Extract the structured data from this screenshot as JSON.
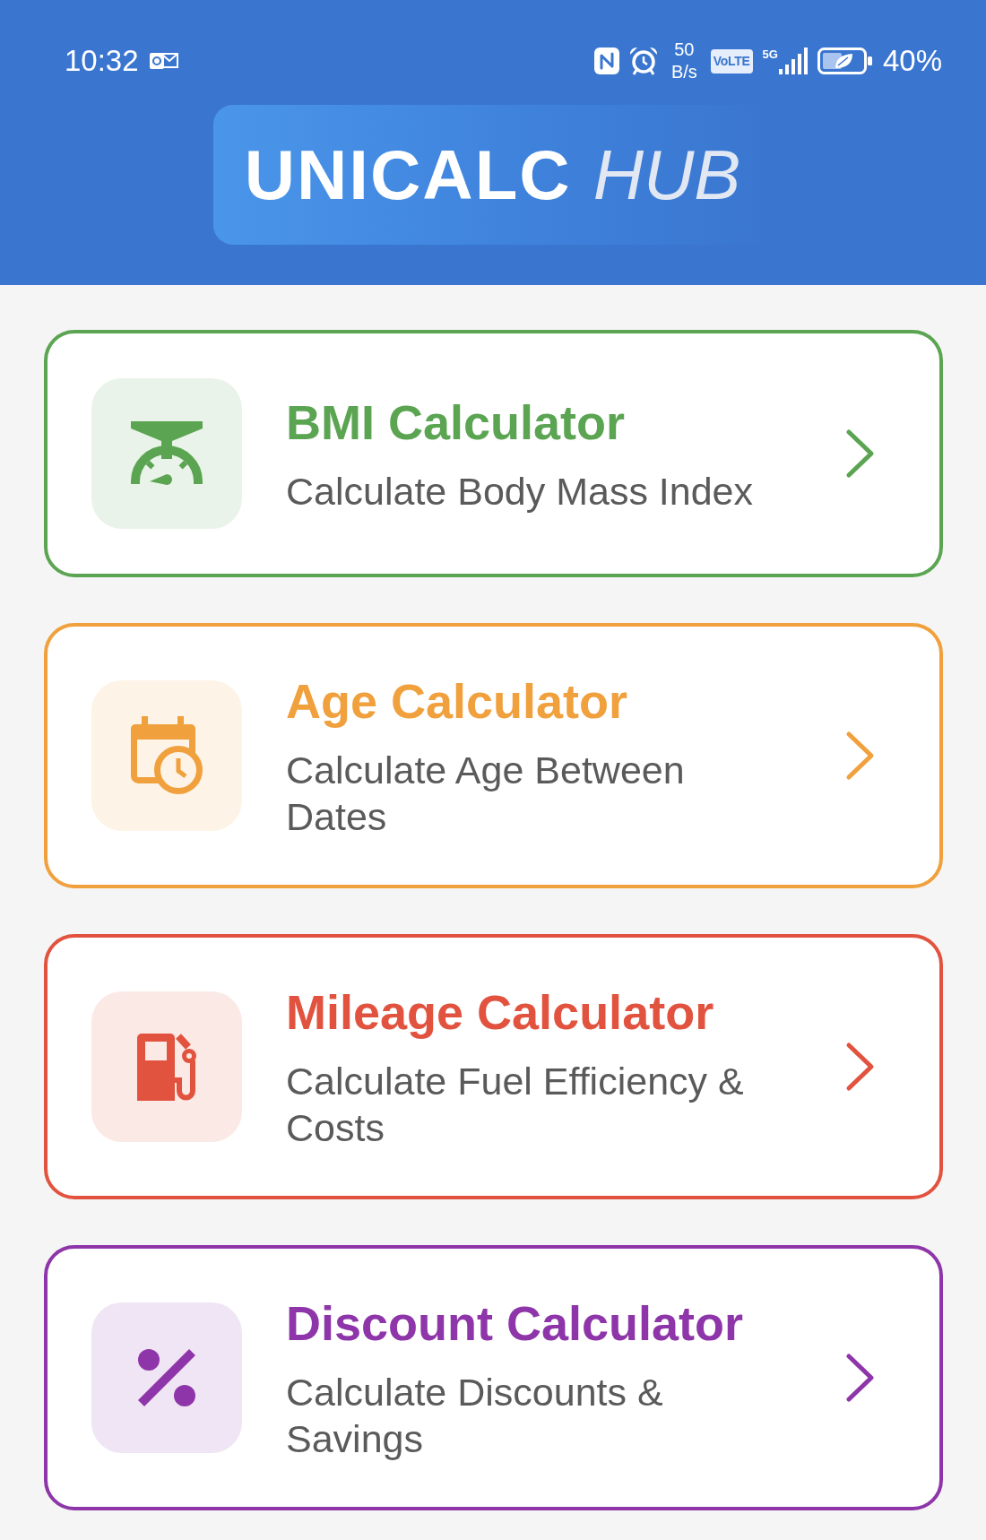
{
  "status_bar": {
    "time": "10:32",
    "network_speed": {
      "value": "50",
      "unit": "B/s"
    },
    "volte": "VoLTE",
    "network_type": "5G",
    "battery": "40%"
  },
  "header": {
    "title": {
      "main": "UNICALC",
      "accent": "HUB"
    }
  },
  "calculators": [
    {
      "title": "BMI Calculator",
      "subtitle": "Calculate Body Mass Index",
      "color": "#5ba552"
    },
    {
      "title": "Age Calculator",
      "subtitle": "Calculate Age Between Dates",
      "color": "#f0a03c"
    },
    {
      "title": "Mileage Calculator",
      "subtitle": "Calculate Fuel Efficiency & Costs",
      "color": "#e2533f"
    },
    {
      "title": "Discount Calculator",
      "subtitle": "Calculate Discounts & Savings",
      "color": "#8e36a9"
    }
  ]
}
